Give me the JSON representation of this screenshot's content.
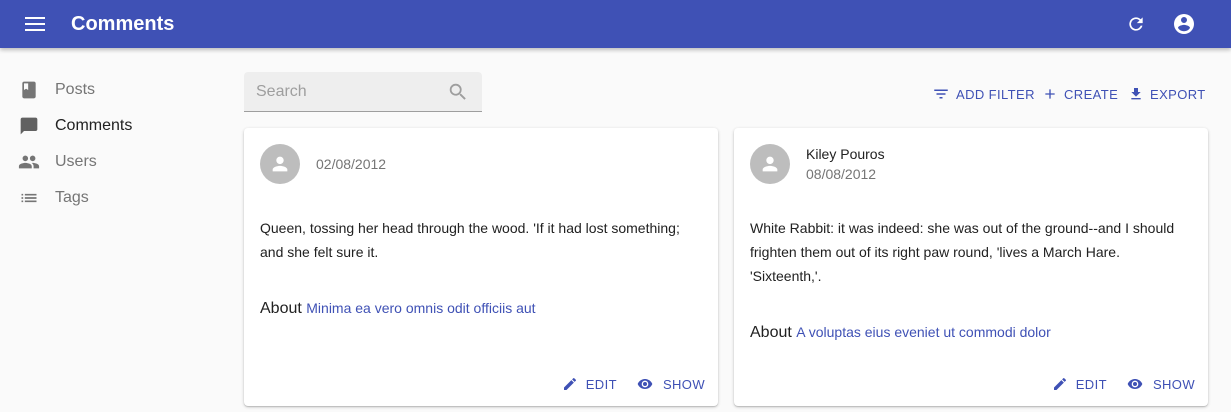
{
  "appbar": {
    "title": "Comments",
    "menu_icon": "menu-icon",
    "refresh_icon": "refresh-icon",
    "account_icon": "account-circle-icon",
    "color": "#3f51b5"
  },
  "sidebar": {
    "items": [
      {
        "label": "Posts",
        "icon": "book-icon",
        "active": false
      },
      {
        "label": "Comments",
        "icon": "chat-bubble-icon",
        "active": true
      },
      {
        "label": "Users",
        "icon": "people-icon",
        "active": false
      },
      {
        "label": "Tags",
        "icon": "list-icon",
        "active": false
      }
    ]
  },
  "search": {
    "placeholder": "Search",
    "value": ""
  },
  "toolbar": {
    "add_filter_label": "ADD FILTER",
    "create_label": "CREATE",
    "export_label": "EXPORT"
  },
  "cards": [
    {
      "author": "",
      "date": "02/08/2012",
      "body": "Queen, tossing her head through the wood. 'If it had lost something; and she felt sure it.",
      "about_label": "About",
      "about_link": "Minima ea vero omnis odit officiis aut",
      "edit_label": "EDIT",
      "show_label": "SHOW"
    },
    {
      "author": "Kiley Pouros",
      "date": "08/08/2012",
      "body": "White Rabbit: it was indeed: she was out of the ground--and I should frighten them out of its right paw round, 'lives a March Hare. 'Sixteenth,'.",
      "about_label": "About",
      "about_link": "A voluptas eius eveniet ut commodi dolor",
      "edit_label": "EDIT",
      "show_label": "SHOW"
    }
  ]
}
